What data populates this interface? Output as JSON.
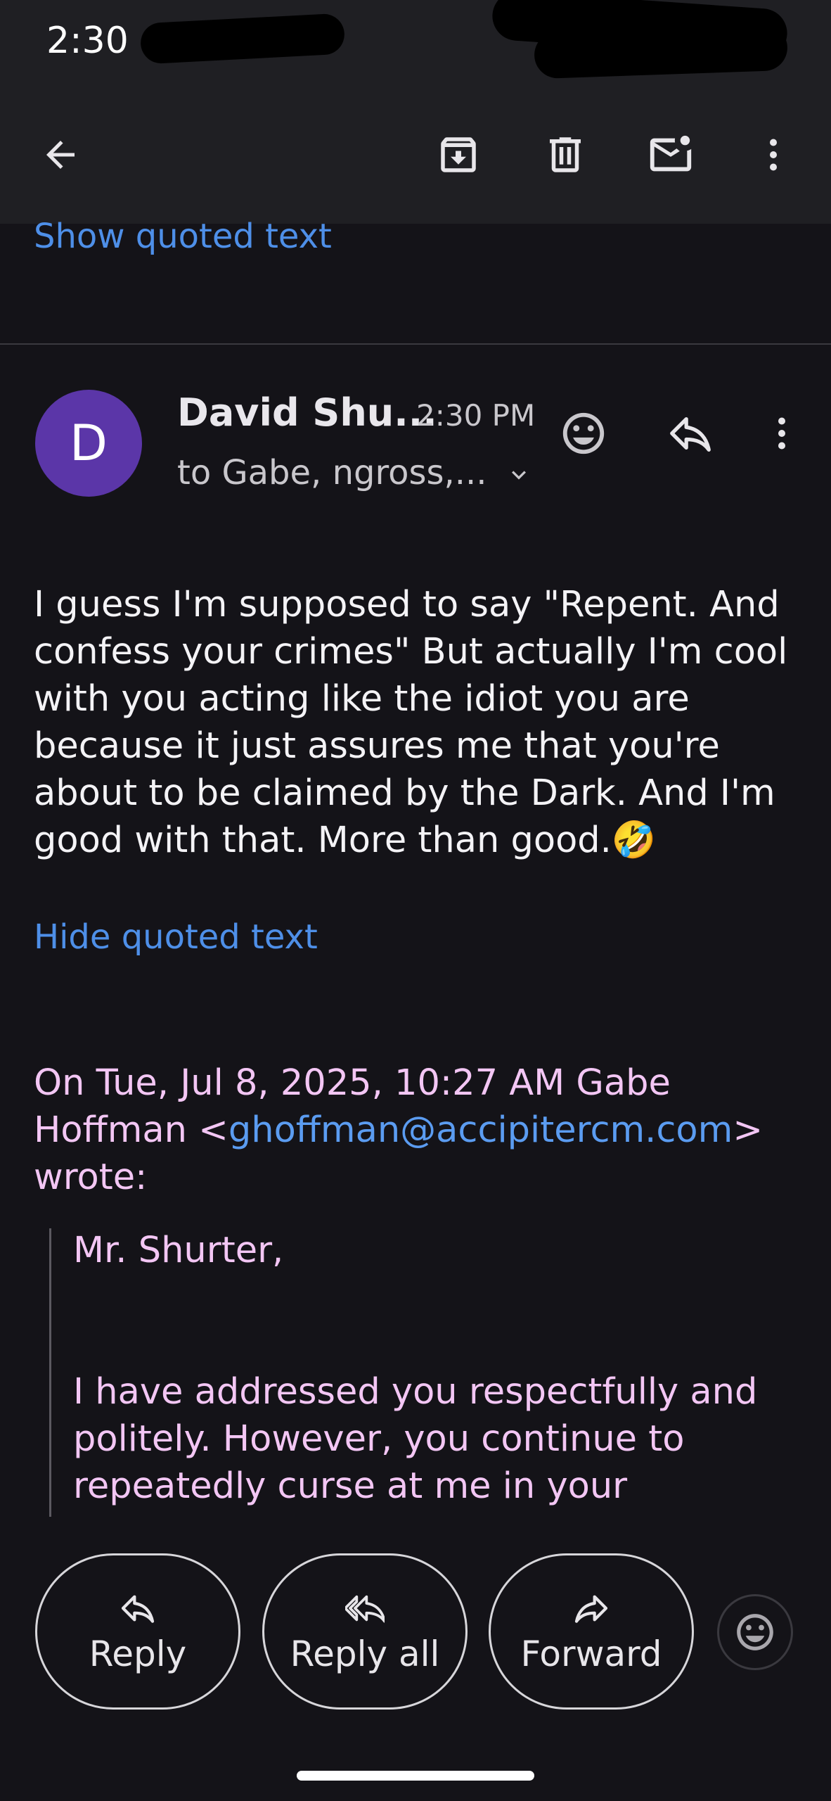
{
  "status_bar": {
    "time": "2:30"
  },
  "toolbar": {
    "back_icon": "arrow-left-icon",
    "archive_icon": "archive-icon",
    "delete_icon": "trash-icon",
    "unread_icon": "mark-unread-icon",
    "more_icon": "more-vert-icon"
  },
  "thread": {
    "show_quoted_text": "Show quoted text"
  },
  "message": {
    "avatar_letter": "D",
    "sender_name": "David Shu...",
    "time": "2:30 PM",
    "recipients": "to Gabe, ngross,...",
    "body": "I guess I'm supposed to say \"Repent. And confess your crimes\" But actually I'm cool with you acting like the idiot you are because it just assures me that you're about to be claimed by the Dark. And I'm good with that. More than good.",
    "body_emoji": "🤣",
    "hide_quoted_text": "Hide quoted text",
    "quote_header_prefix": "On Tue, Jul 8, 2025, 10:27 AM Gabe Hoffman <",
    "quote_email": "ghoffman@accipitercm.com",
    "quote_header_suffix": "> wrote:",
    "quote_salutation": "Mr. Shurter,",
    "quote_body": "I have addressed you respectfully and politely.  However, you continue to repeatedly curse at me in your"
  },
  "actions": {
    "reply": "Reply",
    "reply_all": "Reply all",
    "forward": "Forward"
  },
  "colors": {
    "background": "#141318",
    "toolbar": "#1f1f23",
    "link": "#4e8fe8",
    "avatar": "#5b36a8",
    "quoted_text": "#f3c6f4"
  }
}
